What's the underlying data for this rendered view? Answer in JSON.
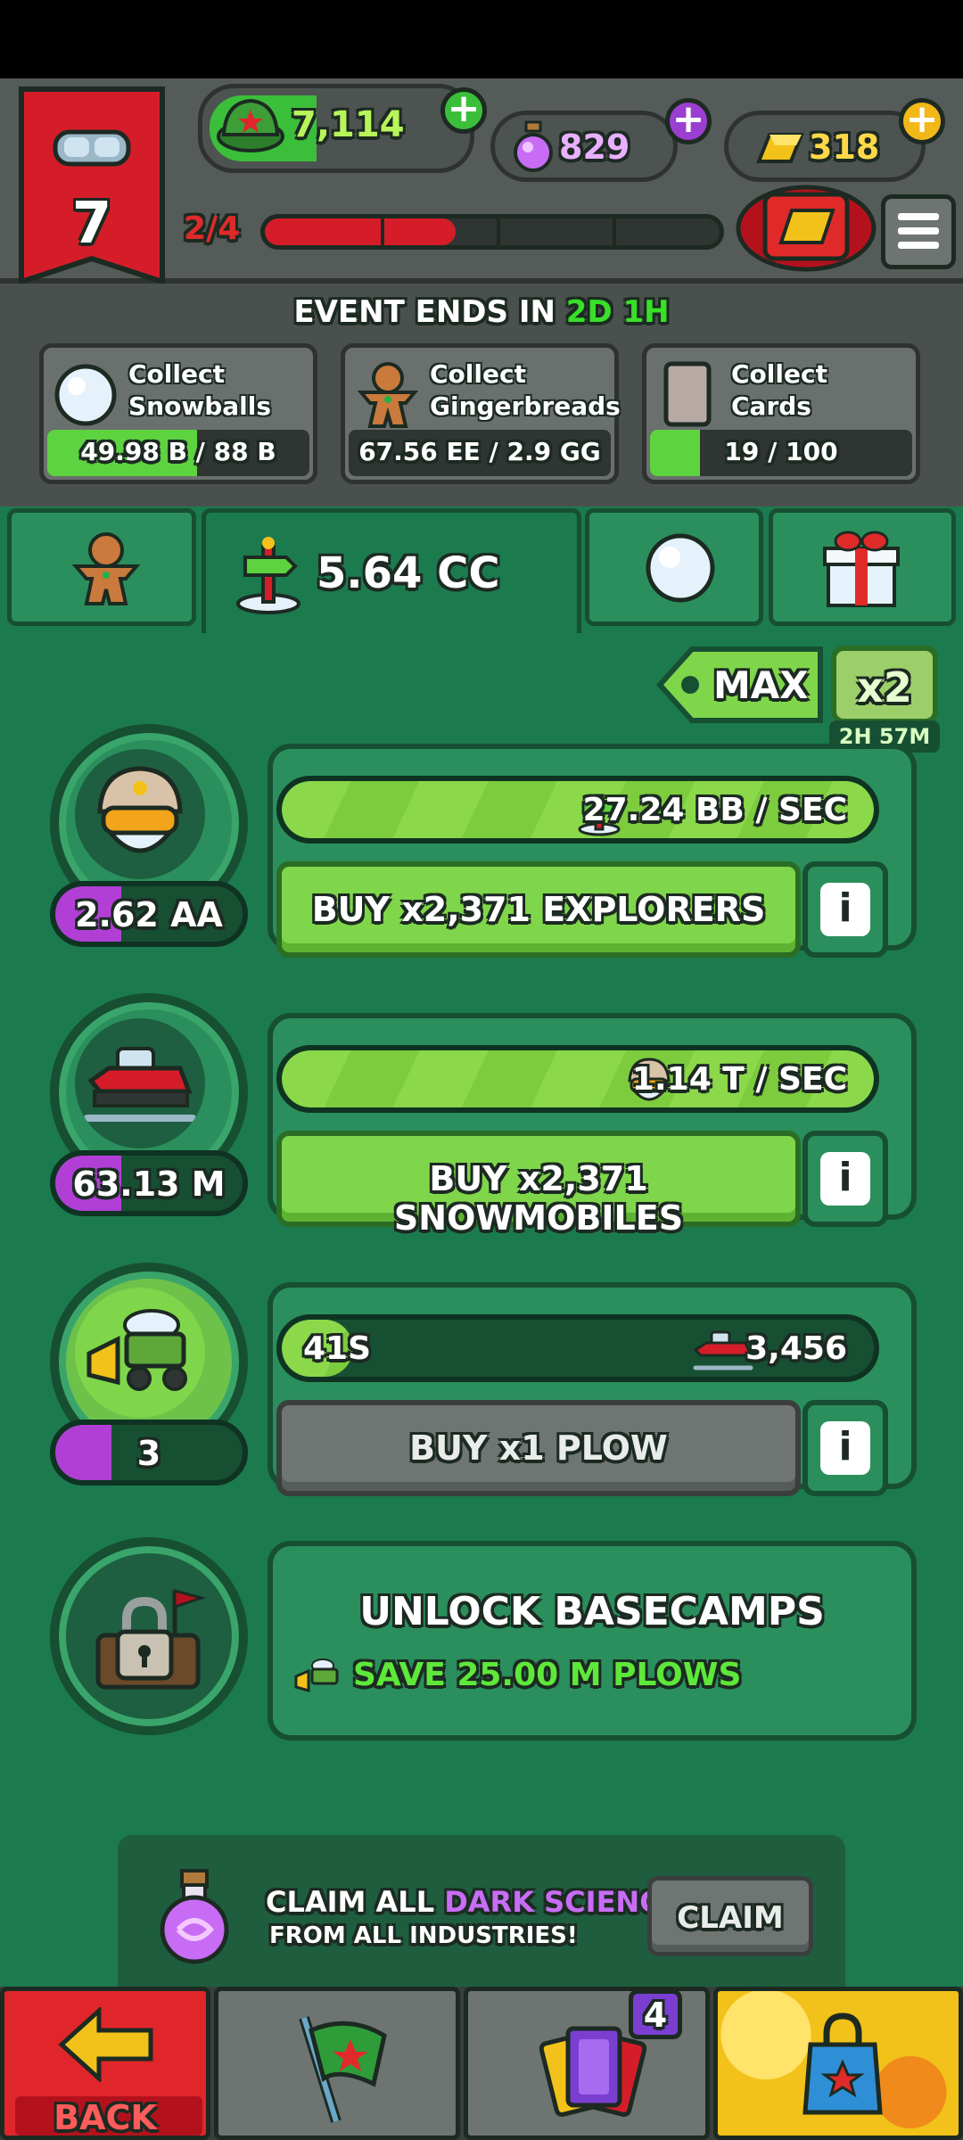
{
  "level": {
    "number": "7"
  },
  "currencies": {
    "green": {
      "value": "7,114"
    },
    "purple": {
      "value": "829"
    },
    "gold": {
      "value": "318"
    }
  },
  "progress": {
    "text": "2/4",
    "fraction": 0.42
  },
  "event": {
    "prefix": "EVENT ENDS IN",
    "time": "2D 1H"
  },
  "quests": [
    {
      "title": "Collect\nSnowballs",
      "progress": "49.98 B / 88 B",
      "fraction": 0.57
    },
    {
      "title": "Collect\nGingerbreads",
      "progress": "67.56 EE / 2.9 GG",
      "fraction": 0.0
    },
    {
      "title": "Collect Cards",
      "progress": "19 / 100",
      "fraction": 0.19
    }
  ],
  "resource": {
    "value": "5.64 CC"
  },
  "multiplier": {
    "max_label": "MAX",
    "boost_label": "x2",
    "timer": "2H 57M"
  },
  "upgrades": [
    {
      "count": "2.62 AA",
      "count_fill": 0.35,
      "rate": "27.24 BB / SEC",
      "rate_fill": 1.0,
      "buy_label": "BUY x2,371 EXPLORERS",
      "enabled": true
    },
    {
      "count": "63.13 M",
      "count_fill": 0.35,
      "rate": "1.14 T / SEC",
      "rate_fill": 1.0,
      "buy_label": "BUY x2,371 SNOWMOBILES",
      "enabled": true
    },
    {
      "count": "3",
      "count_fill": 0.3,
      "timer": "41S",
      "rate": "3,456",
      "rate_fill": 0.12,
      "buy_label": "BUY x1 PLOW",
      "enabled": false
    }
  ],
  "basecamp": {
    "title": "UNLOCK BASECAMPS",
    "requirement": "SAVE 25.00 M PLOWS"
  },
  "claim": {
    "line1_prefix": "CLAIM ALL",
    "line1_highlight": "DARK SCIENCE",
    "line2": "FROM ALL INDUSTRIES!",
    "button": "CLAIM"
  },
  "nav": {
    "back_label": "BACK",
    "cards_badge": "4"
  },
  "colors": {
    "accent_green": "#5ed340",
    "event_green": "#38e028",
    "dark_science": "#c86cf5",
    "red": "#d51d2a",
    "gold": "#f2c21a"
  }
}
